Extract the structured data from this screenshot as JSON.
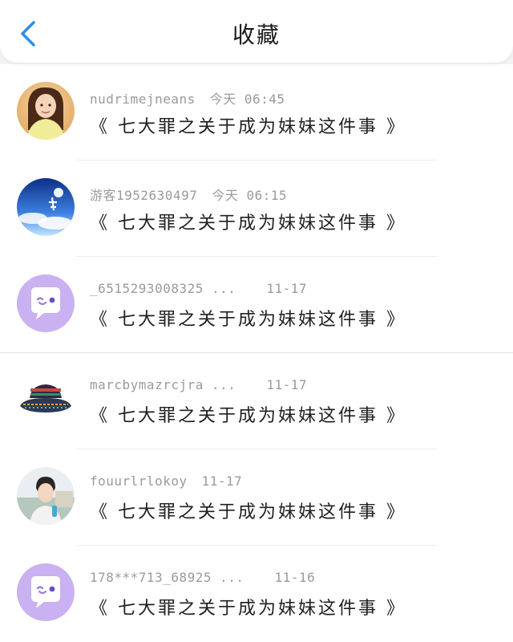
{
  "header": {
    "title": "收藏"
  },
  "items": [
    {
      "user": "nudrimejneans",
      "time": "今天 06:45",
      "text": "《 七大罪之关于成为妹妹这件事 》",
      "avatar": "photo-girl-yellow"
    },
    {
      "user": "游客1952630497",
      "time": "今天 06:15",
      "text": "《 七大罪之关于成为妹妹这件事 》",
      "avatar": "mid-autumn-blue"
    },
    {
      "user": "_6515293008325 ...",
      "time": "11-17",
      "text": "《 七大罪之关于成为妹妹这件事 》",
      "avatar": "default-chat-bubble"
    },
    {
      "user": "marcbymazrcjra ...",
      "time": "11-17",
      "text": "《 七大罪之关于成为妹妹这件事 》",
      "avatar": "bucket-hat"
    },
    {
      "user": "fouurlrlokoy",
      "time": "11-17",
      "text": "《 七大罪之关于成为妹妹这件事 》",
      "avatar": "photo-boy"
    },
    {
      "user": "178***713_68925 ...",
      "time": "11-16",
      "text": "《 七大罪之关于成为妹妹这件事 》",
      "avatar": "default-chat-bubble"
    }
  ],
  "colors": {
    "accent": "#2a8df0",
    "default_avatar_bg": "#c9b1f2"
  }
}
